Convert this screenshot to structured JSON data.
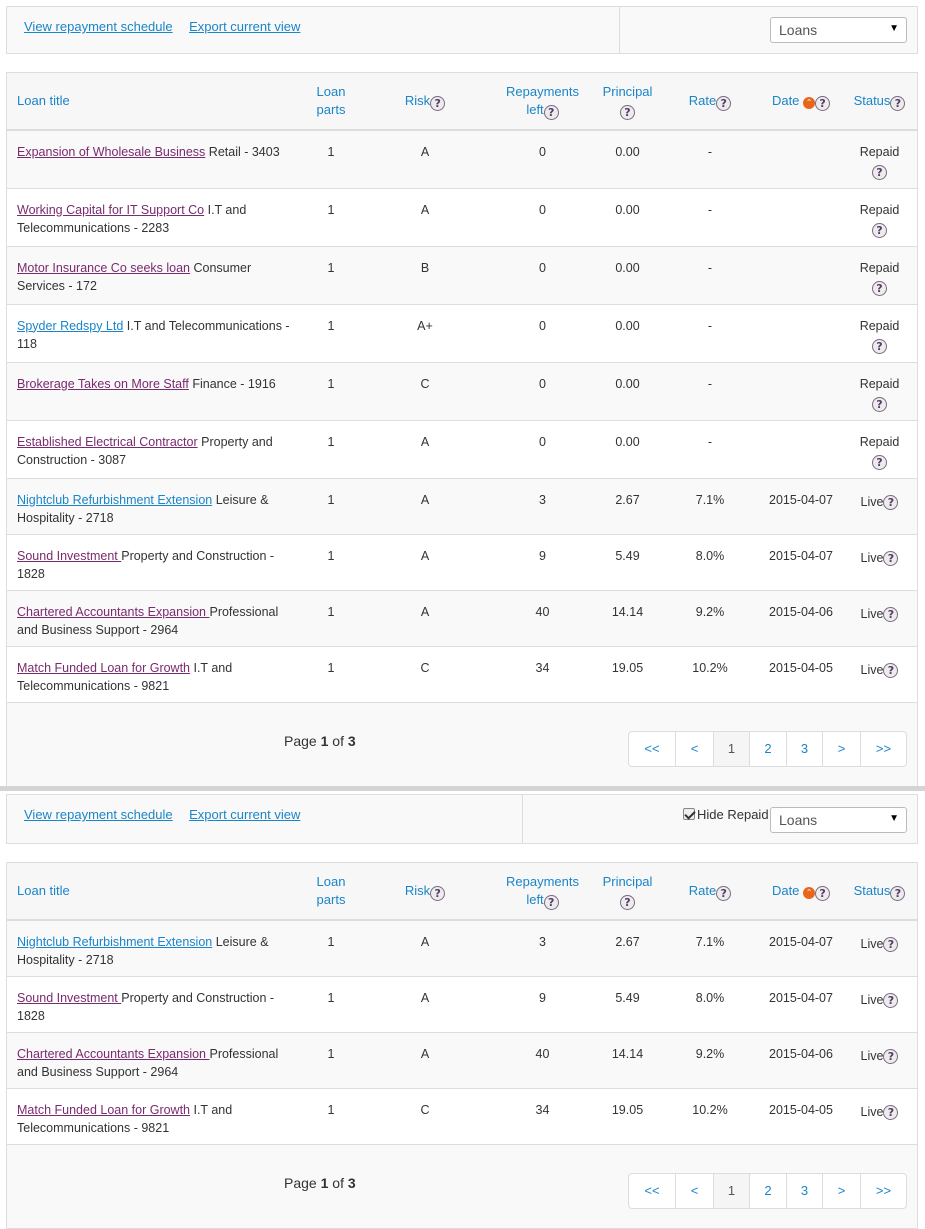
{
  "toolbar": {
    "view_schedule": "View repayment schedule",
    "export_view": "Export current view",
    "select_value": "Loans",
    "hide_repaid_label": "Hide Repaid"
  },
  "headers": {
    "title": "Loan title",
    "loan_parts_1": "Loan",
    "loan_parts_2": "parts",
    "risk": "Risk",
    "repayments_1": "Repayments",
    "repayments_2": "left",
    "principal": "Principal",
    "rate": "Rate",
    "date": "Date",
    "status": "Status"
  },
  "help_glyph": "?",
  "sort_glyph": "⌃",
  "table1": {
    "rows": [
      {
        "name": "Expansion of Wholesale Business",
        "sector": " Retail - 3403",
        "parts": "1",
        "risk": "A",
        "repayments": "0",
        "principal": "0.00",
        "rate": "-",
        "date": "",
        "status": "Repaid"
      },
      {
        "name": "Working Capital for IT Support Co",
        "sector": " I.T and Telecommunications - 2283",
        "parts": "1",
        "risk": "A",
        "repayments": "0",
        "principal": "0.00",
        "rate": "-",
        "date": "",
        "status": "Repaid"
      },
      {
        "name": "Motor Insurance Co seeks loan",
        "sector": " Consumer Services - 172",
        "parts": "1",
        "risk": "B",
        "repayments": "0",
        "principal": "0.00",
        "rate": "-",
        "date": "",
        "status": "Repaid"
      },
      {
        "name": "Spyder Redspy Ltd",
        "sector": " I.T and Telecommunications - 118",
        "parts": "1",
        "risk": "A+",
        "repayments": "0",
        "principal": "0.00",
        "rate": "-",
        "date": "",
        "status": "Repaid"
      },
      {
        "name": "Brokerage Takes on More Staff",
        "sector": " Finance - 1916",
        "parts": "1",
        "risk": "C",
        "repayments": "0",
        "principal": "0.00",
        "rate": "-",
        "date": "",
        "status": "Repaid"
      },
      {
        "name": "Established Electrical Contractor",
        "sector": " Property and Construction - 3087",
        "parts": "1",
        "risk": "A",
        "repayments": "0",
        "principal": "0.00",
        "rate": "-",
        "date": "",
        "status": "Repaid"
      },
      {
        "name": "Nightclub Refurbishment Extension",
        "sector": " Leisure & Hospitality - 2718",
        "parts": "1",
        "risk": "A",
        "repayments": "3",
        "principal": "2.67",
        "rate": "7.1%",
        "date": "2015-04-07",
        "status": "Live"
      },
      {
        "name": "Sound Investment ",
        "sector": "Property and Construction - 1828",
        "parts": "1",
        "risk": "A",
        "repayments": "9",
        "principal": "5.49",
        "rate": "8.0%",
        "date": "2015-04-07",
        "status": "Live"
      },
      {
        "name": "Chartered Accountants Expansion ",
        "sector": "Professional and Business Support - 2964",
        "parts": "1",
        "risk": "A",
        "repayments": "40",
        "principal": "14.14",
        "rate": "9.2%",
        "date": "2015-04-06",
        "status": "Live"
      },
      {
        "name": "Match Funded Loan for Growth",
        "sector": " I.T and Telecommunications - 9821",
        "parts": "1",
        "risk": "C",
        "repayments": "34",
        "principal": "19.05",
        "rate": "10.2%",
        "date": "2015-04-05",
        "status": "Live"
      }
    ]
  },
  "table2": {
    "rows": [
      {
        "name": "Nightclub Refurbishment Extension",
        "sector": " Leisure & Hospitality - 2718",
        "parts": "1",
        "risk": "A",
        "repayments": "3",
        "principal": "2.67",
        "rate": "7.1%",
        "date": "2015-04-07",
        "status": "Live"
      },
      {
        "name": "Sound Investment ",
        "sector": "Property and Construction - 1828",
        "parts": "1",
        "risk": "A",
        "repayments": "9",
        "principal": "5.49",
        "rate": "8.0%",
        "date": "2015-04-07",
        "status": "Live"
      },
      {
        "name": "Chartered Accountants Expansion ",
        "sector": "Professional and Business Support - 2964",
        "parts": "1",
        "risk": "A",
        "repayments": "40",
        "principal": "14.14",
        "rate": "9.2%",
        "date": "2015-04-06",
        "status": "Live"
      },
      {
        "name": "Match Funded Loan for Growth",
        "sector": " I.T and Telecommunications - 9821",
        "parts": "1",
        "risk": "C",
        "repayments": "34",
        "principal": "19.05",
        "rate": "10.2%",
        "date": "2015-04-05",
        "status": "Live"
      }
    ]
  },
  "pagination": {
    "page_word": "Page",
    "current": "1",
    "of_word": "of",
    "total": "3",
    "buttons": [
      "<<",
      "<",
      "1",
      "2",
      "3",
      ">",
      ">>"
    ]
  },
  "colors": {
    "link": "#1a85c8",
    "visited_link": "#7a2a6e",
    "sort_icon": "#e8651a"
  }
}
